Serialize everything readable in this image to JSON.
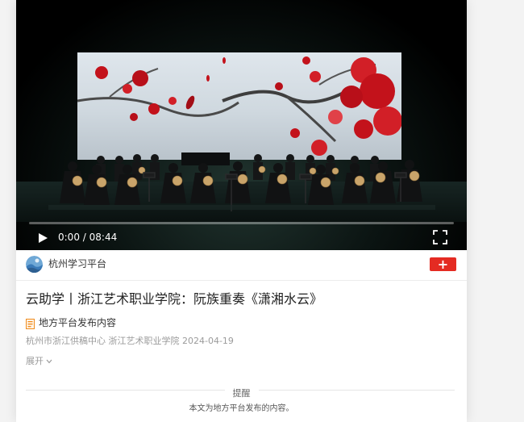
{
  "video": {
    "current_time": "0:00",
    "duration": "08:44",
    "time_separator": " / ",
    "progress": 0.0,
    "play_icon": "play-icon",
    "fullscreen_icon": "fullscreen-icon"
  },
  "publisher": {
    "name": "杭州学习平台",
    "follow_label": "+",
    "follow_color": "#e42b22"
  },
  "article": {
    "title": "云助学丨浙江艺术职业学院：阮族重奏《潇湘水云》",
    "source_tag": "地方平台发布内容",
    "meta": "杭州市浙江供稿中心 浙江艺术职业学院 2024-04-19",
    "expand_label": "展开"
  },
  "notice": {
    "title": "提醒",
    "body": "本文为地方平台发布的内容。"
  }
}
